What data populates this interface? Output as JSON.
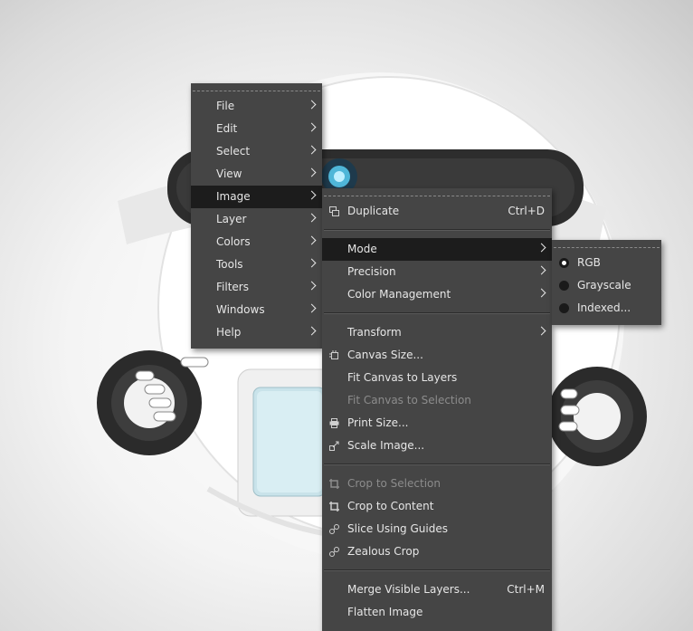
{
  "colors": {
    "menu_bg": "#454545",
    "menu_text": "#e6e6e6",
    "highlight": "#1c1c1c",
    "disabled_text": "#8c8c8c"
  },
  "main_menu": {
    "items": [
      {
        "label": "File"
      },
      {
        "label": "Edit"
      },
      {
        "label": "Select"
      },
      {
        "label": "View"
      },
      {
        "label": "Image"
      },
      {
        "label": "Layer"
      },
      {
        "label": "Colors"
      },
      {
        "label": "Tools"
      },
      {
        "label": "Filters"
      },
      {
        "label": "Windows"
      },
      {
        "label": "Help"
      }
    ],
    "active": "Image"
  },
  "image_menu": {
    "duplicate": {
      "label": "Duplicate",
      "shortcut": "Ctrl+D",
      "icon": "duplicate-icon"
    },
    "mode": {
      "label": "Mode"
    },
    "precision": {
      "label": "Precision"
    },
    "color_management": {
      "label": "Color Management"
    },
    "transform": {
      "label": "Transform"
    },
    "canvas_size": {
      "label": "Canvas Size...",
      "icon": "canvas-size-icon"
    },
    "fit_canvas_to_layers": {
      "label": "Fit Canvas to Layers"
    },
    "fit_canvas_to_selection": {
      "label": "Fit Canvas to Selection",
      "disabled": true
    },
    "print_size": {
      "label": "Print Size...",
      "icon": "printer-icon"
    },
    "scale_image": {
      "label": "Scale Image...",
      "icon": "scale-icon"
    },
    "crop_to_selection": {
      "label": "Crop to Selection",
      "icon": "crop-icon",
      "disabled": true
    },
    "crop_to_content": {
      "label": "Crop to Content",
      "icon": "crop-icon"
    },
    "slice_using_guides": {
      "label": "Slice Using Guides",
      "icon": "guides-icon"
    },
    "zealous_crop": {
      "label": "Zealous Crop",
      "icon": "guides-icon"
    },
    "merge_visible_layers": {
      "label": "Merge Visible Layers...",
      "shortcut": "Ctrl+M"
    },
    "flatten_image": {
      "label": "Flatten Image"
    }
  },
  "mode_menu": {
    "options": [
      {
        "label": "RGB",
        "selected": true
      },
      {
        "label": "Grayscale",
        "selected": false
      },
      {
        "label": "Indexed...",
        "selected": false
      }
    ]
  }
}
